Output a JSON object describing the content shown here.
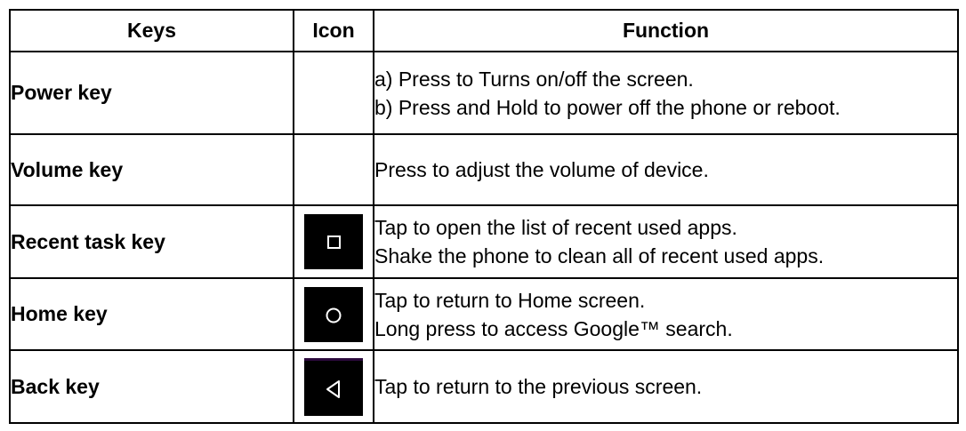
{
  "table": {
    "headers": {
      "keys": "Keys",
      "icon": "Icon",
      "function": "Function"
    },
    "rows": [
      {
        "key": "Power key",
        "icon": "",
        "function": [
          "a) Press to Turns on/off the screen.",
          "b) Press and Hold to power off the phone or reboot."
        ]
      },
      {
        "key": "Volume key",
        "icon": "",
        "function": [
          "Press to adjust the volume of device."
        ]
      },
      {
        "key": "Recent task key",
        "icon": "recent-apps-square-icon",
        "function": [
          "Tap to open the list of recent used apps.",
          "Shake the phone to clean all of recent used apps."
        ]
      },
      {
        "key": "Home key",
        "icon": "home-circle-icon",
        "function": [
          "Tap to return to Home screen.",
          "Long press to access Google™ search."
        ]
      },
      {
        "key": "Back key",
        "icon": "back-triangle-icon",
        "function": [
          "Tap to return to the previous screen."
        ]
      }
    ]
  },
  "colors": {
    "icon_background": "#000000",
    "icon_glyph": "#ffffff",
    "border": "#000000"
  }
}
